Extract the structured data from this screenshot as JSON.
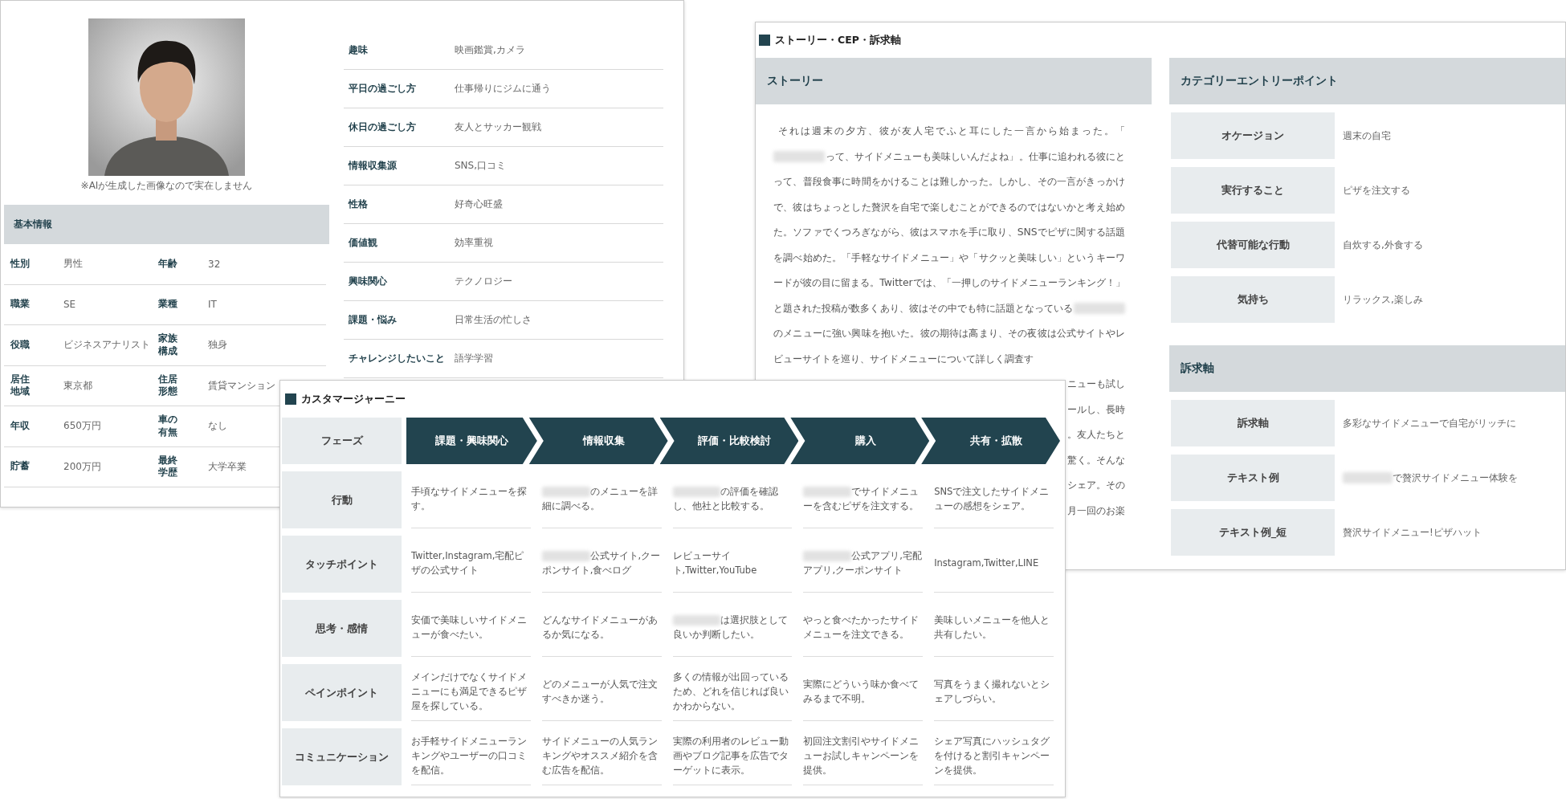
{
  "persona": {
    "photo_caption": "※AIが生成した画像なので実在しません",
    "basic_info": {
      "title": "基本情報",
      "rows": [
        [
          {
            "label": "性別",
            "value": "男性"
          },
          {
            "label": "年齢",
            "value": "32"
          }
        ],
        [
          {
            "label": "職業",
            "value": "SE"
          },
          {
            "label": "業種",
            "value": "IT"
          }
        ],
        [
          {
            "label": "役職",
            "value": "ビジネスアナリスト"
          },
          {
            "label": "家族構成",
            "value": "独身"
          }
        ],
        [
          {
            "label": "居住地域",
            "value": "東京都"
          },
          {
            "label": "住居形態",
            "value": "賃貸マンション"
          }
        ],
        [
          {
            "label": "年収",
            "value": "650万円"
          },
          {
            "label": "車の有無",
            "value": "なし"
          }
        ],
        [
          {
            "label": "貯蓄",
            "value": "200万円"
          },
          {
            "label": "最終学歴",
            "value": "大学卒業"
          }
        ]
      ]
    },
    "profile": [
      {
        "label": "趣味",
        "value": "映画鑑賞,カメラ"
      },
      {
        "label": "平日の過ごし方",
        "value": "仕事帰りにジムに通う"
      },
      {
        "label": "休日の過ごし方",
        "value": "友人とサッカー観戦"
      },
      {
        "label": "情報収集源",
        "value": "SNS,口コミ"
      },
      {
        "label": "性格",
        "value": "好奇心旺盛"
      },
      {
        "label": "価値観",
        "value": "効率重視"
      },
      {
        "label": "興味関心",
        "value": "テクノロジー"
      },
      {
        "label": "課題・悩み",
        "value": "日常生活の忙しさ"
      },
      {
        "label": "チャレンジしたいこと",
        "value": "語学学習"
      }
    ]
  },
  "story_panel": {
    "title": "ストーリー・CEP・訴求軸",
    "story": {
      "heading": "ストーリー",
      "parts": [
        {
          "kind": "text",
          "text": "それは週末の夕方、彼が友人宅でふと耳にした一言から始まった。「"
        },
        {
          "kind": "redacted"
        },
        {
          "kind": "text",
          "text": "って、サイドメニューも美味しいんだよね」。仕事に追われる彼にとって、普段食事に時間をかけることは難しかった。しかし、その一言がきっかけで、彼はちょっとした贅沢を自宅で楽しむことができるのではないかと考え始めた。ソファでくつろぎながら、彼はスマホを手に取り、SNSでピザに関する話題を調べ始めた。「手軽なサイドメニュー」や「サクッと美味しい」というキーワードが彼の目に留まる。Twitterでは、「一押しのサイドメニューランキング！」と題された投稿が数多くあり、彼はその中でも特に話題となっている"
        },
        {
          "kind": "redacted"
        },
        {
          "kind": "text",
          "text": "のメニューに強い興味を抱いた。彼の期待は高まり、その夜彼は公式サイトやレビューサイトを巡り、サイドメニューについて詳しく調査す"
        }
      ],
      "covered_fragments": [
        "ニューも試し",
        "ールし、長時",
        "。友人たちと",
        "驚く。そんな",
        "シェア。その",
        "月一回のお楽"
      ]
    },
    "cep": {
      "heading": "カテゴリーエントリーポイント",
      "rows": [
        {
          "label": "オケージョン",
          "value": "週末の自宅"
        },
        {
          "label": "実行すること",
          "value": "ピザを注文する"
        },
        {
          "label": "代替可能な行動",
          "value": "自炊する,外食する"
        },
        {
          "label": "気持ち",
          "value": "リラックス,楽しみ"
        }
      ]
    },
    "appeal": {
      "heading": "訴求軸",
      "rows": [
        {
          "label": "訴求軸",
          "value": "多彩なサイドメニューで自宅がリッチに"
        },
        {
          "label": "テキスト例",
          "value": "で贅沢サイドメニュー体験を",
          "redacted_lead": true
        },
        {
          "label": "テキスト例_短",
          "value": "贅沢サイドメニュー!ピザハット"
        }
      ]
    }
  },
  "journey": {
    "title": "カスタマージャーニー",
    "phase_label": "フェーズ",
    "phases": [
      "課題・興味関心",
      "情報収集",
      "評価・比較検討",
      "購入",
      "共有・拡散"
    ],
    "rows": [
      {
        "label": "行動",
        "cells": [
          {
            "text": "手頃なサイドメニューを探す。"
          },
          {
            "text": "のメニューを詳細に調べる。",
            "redacted_lead": true
          },
          {
            "text": "の評価を確認し、他社と比較する。",
            "redacted_lead": true
          },
          {
            "text": "でサイドメニューを含むピザを注文する。",
            "redacted_lead": true
          },
          {
            "text": "SNSで注文したサイドメニューの感想をシェア。"
          }
        ]
      },
      {
        "label": "タッチポイント",
        "cells": [
          {
            "text": "Twitter,Instagram,宅配ピザの公式サイト"
          },
          {
            "text": "公式サイト,クーポンサイト,食べログ",
            "redacted_lead": true
          },
          {
            "text": "レビューサイト,Twitter,YouTube"
          },
          {
            "text": "公式アプリ,宅配アプリ,クーポンサイト",
            "redacted_lead": true
          },
          {
            "text": "Instagram,Twitter,LINE"
          }
        ]
      },
      {
        "label": "思考・感情",
        "cells": [
          {
            "text": "安価で美味しいサイドメニューが食べたい。"
          },
          {
            "text": "どんなサイドメニューがあるか気になる。"
          },
          {
            "text": "は選択肢として良いか判断したい。",
            "redacted_lead": true
          },
          {
            "text": "やっと食べたかったサイドメニューを注文できる。"
          },
          {
            "text": "美味しいメニューを他人と共有したい。"
          }
        ]
      },
      {
        "label": "ペインポイント",
        "cells": [
          {
            "text": "メインだけでなくサイドメニューにも満足できるピザ屋を探している。"
          },
          {
            "text": "どのメニューが人気で注文すべきか迷う。"
          },
          {
            "text": "多くの情報が出回っているため、どれを信じれば良いかわからない。"
          },
          {
            "text": "実際にどういう味か食べてみるまで不明。"
          },
          {
            "text": "写真をうまく撮れないとシェアしづらい。"
          }
        ]
      },
      {
        "label": "コミュニケーション",
        "cells": [
          {
            "text": "お手軽サイドメニューランキングやユーザーの口コミを配信。"
          },
          {
            "text": "サイドメニューの人気ランキングやオススメ紹介を含む広告を配信。"
          },
          {
            "text": "実際の利用者のレビュー動画やブログ記事を広告でターゲットに表示。"
          },
          {
            "text": "初回注文割引やサイドメニューお試しキャンペーンを提供。"
          },
          {
            "text": "シェア写真にハッシュタグを付けると割引キャンペーンを提供。"
          }
        ]
      }
    ]
  }
}
